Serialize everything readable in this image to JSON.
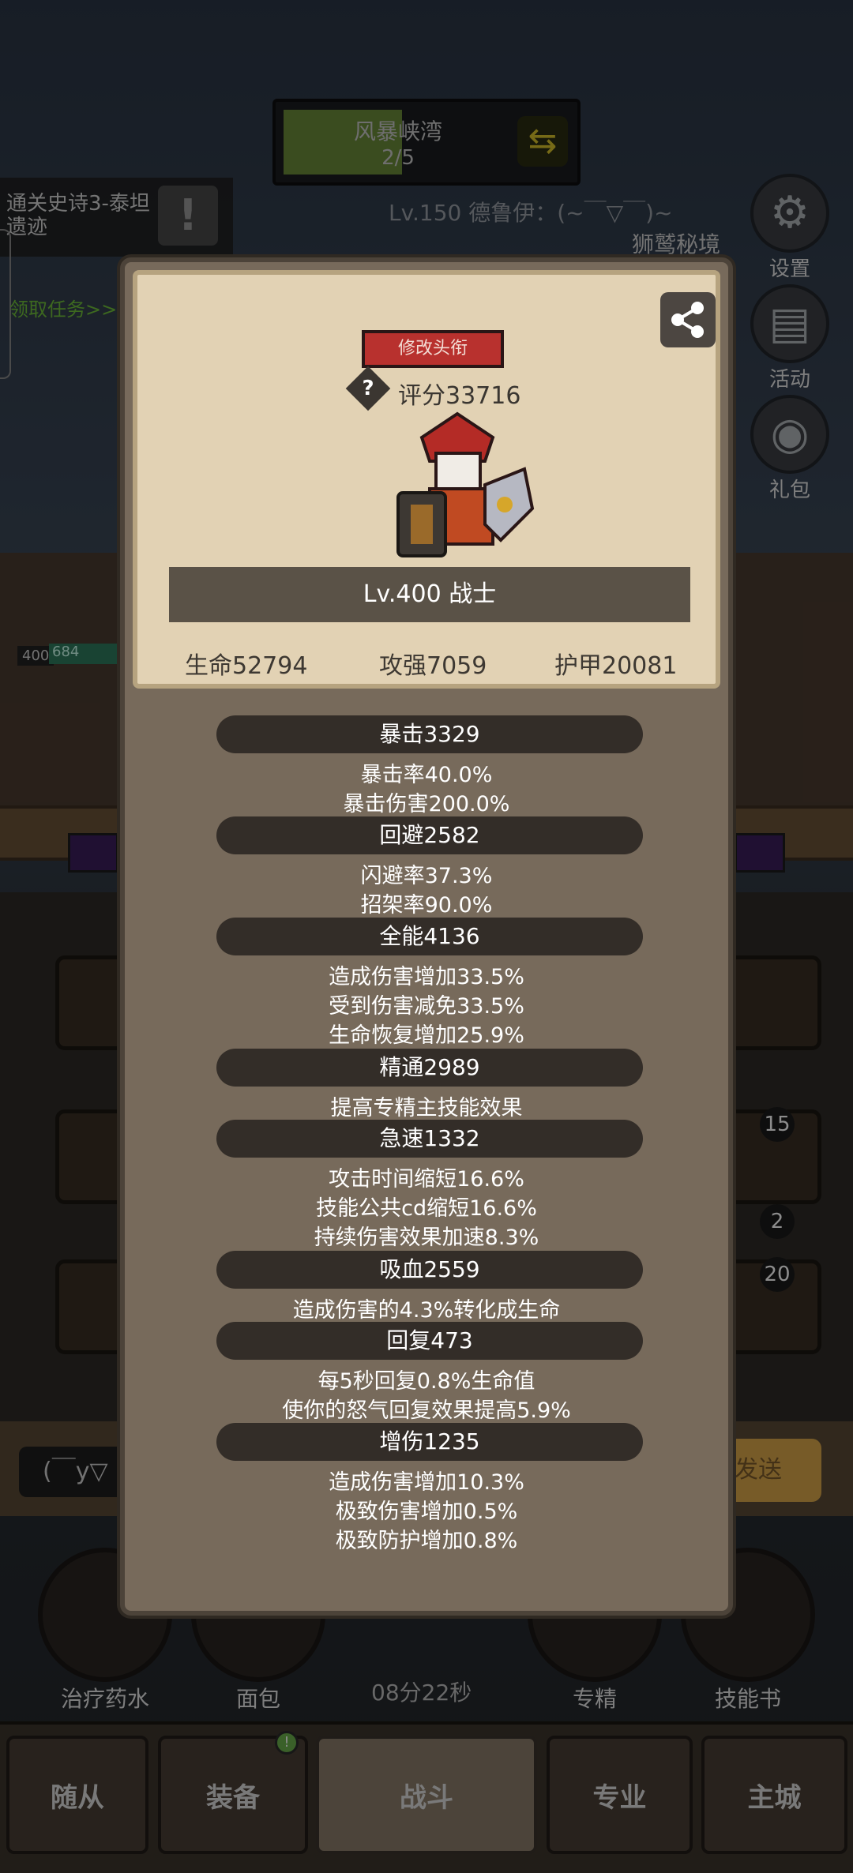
{
  "portal": {
    "title": "风暴峡湾",
    "progress": "2/5"
  },
  "quest": {
    "title": "通关史诗3-泰坦遗迹",
    "take_label": "领取任务>>"
  },
  "player_line": "Lv.150 德鲁伊：(~￣▽￣)~",
  "secret_label": "狮鹫秘境",
  "side_buttons": [
    {
      "label": "设置",
      "icon": "gear-icon"
    },
    {
      "label": "活动",
      "icon": "scroll-icon"
    },
    {
      "label": "礼包",
      "icon": "gift-icon"
    }
  ],
  "mini_level": "400",
  "mini_hp": "684",
  "skill_badges": [
    "15",
    "2",
    "20"
  ],
  "chat": {
    "input_value": "(￣y▽",
    "send_label": "发送"
  },
  "consumables": [
    {
      "label": "治疗药水"
    },
    {
      "label": "面包"
    },
    {
      "label": "专精"
    },
    {
      "label": "技能书"
    }
  ],
  "timer": "08分22秒",
  "tabs": [
    {
      "label": "随从",
      "active": false
    },
    {
      "label": "装备",
      "active": false,
      "badge": "!"
    },
    {
      "label": "战斗",
      "active": true
    },
    {
      "label": "专业",
      "active": false
    },
    {
      "label": "主城",
      "active": false
    }
  ],
  "modal": {
    "title_button": "修改头衔",
    "score": "评分33716",
    "level_banner": "Lv.400 战士",
    "base_stats": {
      "hp": "生命52794",
      "atk": "攻强7059",
      "armor": "护甲20081"
    },
    "sections": [
      {
        "header": "暴击3329",
        "lines": [
          "暴击率40.0%",
          "暴击伤害200.0%"
        ]
      },
      {
        "header": "回避2582",
        "lines": [
          "闪避率37.3%",
          "招架率90.0%"
        ]
      },
      {
        "header": "全能4136",
        "lines": [
          "造成伤害增加33.5%",
          "受到伤害减免33.5%",
          "生命恢复增加25.9%"
        ]
      },
      {
        "header": "精通2989",
        "lines": [
          "提高专精主技能效果"
        ]
      },
      {
        "header": "急速1332",
        "lines": [
          "攻击时间缩短16.6%",
          "技能公共cd缩短16.6%",
          "持续伤害效果加速8.3%"
        ]
      },
      {
        "header": "吸血2559",
        "lines": [
          "造成伤害的4.3%转化成生命"
        ]
      },
      {
        "header": "回复473",
        "lines": [
          "每5秒回复0.8%生命值",
          "使你的怒气回复效果提高5.9%"
        ]
      },
      {
        "header": "增伤1235",
        "lines": [
          "造成伤害增加10.3%",
          "极致伤害增加0.5%",
          "极致防护增加0.8%"
        ]
      }
    ]
  },
  "colors": {
    "accent_red": "#b8312e",
    "panel": "#776a5b",
    "card": "#e2d2b4",
    "stat_pill": "#332d28"
  }
}
